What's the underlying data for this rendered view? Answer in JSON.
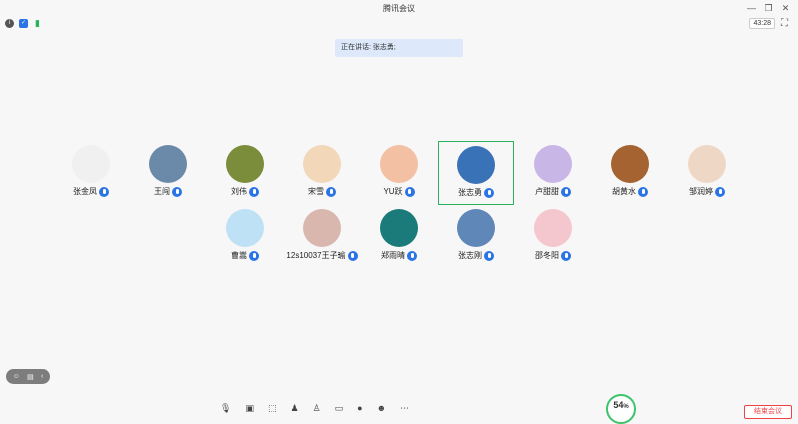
{
  "window": {
    "title": "腾讯会议"
  },
  "status": {
    "timer": "43:28",
    "icons": [
      "info-icon",
      "shield-icon",
      "signal-icon"
    ]
  },
  "speaking": {
    "text": "正在讲话: 张志勇;"
  },
  "participants": [
    {
      "name": "张金凤",
      "active": false,
      "avatar_color": "#f0f0f0"
    },
    {
      "name": "王闯",
      "active": false,
      "avatar_color": "#6b89a8"
    },
    {
      "name": "刘伟",
      "active": false,
      "avatar_color": "#7b8d3b"
    },
    {
      "name": "宋雪",
      "active": false,
      "avatar_color": "#f2d7b8"
    },
    {
      "name": "YU跃",
      "active": false,
      "avatar_color": "#f3c0a4"
    },
    {
      "name": "张志勇",
      "active": true,
      "avatar_color": "#3a72b8"
    },
    {
      "name": "卢甜甜",
      "active": false,
      "avatar_color": "#c8b6e6"
    },
    {
      "name": "胡黄水",
      "active": false,
      "avatar_color": "#a56332"
    },
    {
      "name": "邹润婷",
      "active": false,
      "avatar_color": "#efd7c6"
    },
    {
      "name": "曹嵩",
      "active": false,
      "avatar_color": "#bfe1f5"
    },
    {
      "name": "12s10037王子瑜",
      "active": false,
      "avatar_color": "#d9b7ae"
    },
    {
      "name": "郑雨晴",
      "active": false,
      "avatar_color": "#1a7b7a"
    },
    {
      "name": "张志刚",
      "active": false,
      "avatar_color": "#5f87b8"
    },
    {
      "name": "邵冬阳",
      "active": false,
      "avatar_color": "#f4c7cf"
    }
  ],
  "toolbar": {
    "cpu_percent": "54",
    "end_label": "结束会议"
  }
}
